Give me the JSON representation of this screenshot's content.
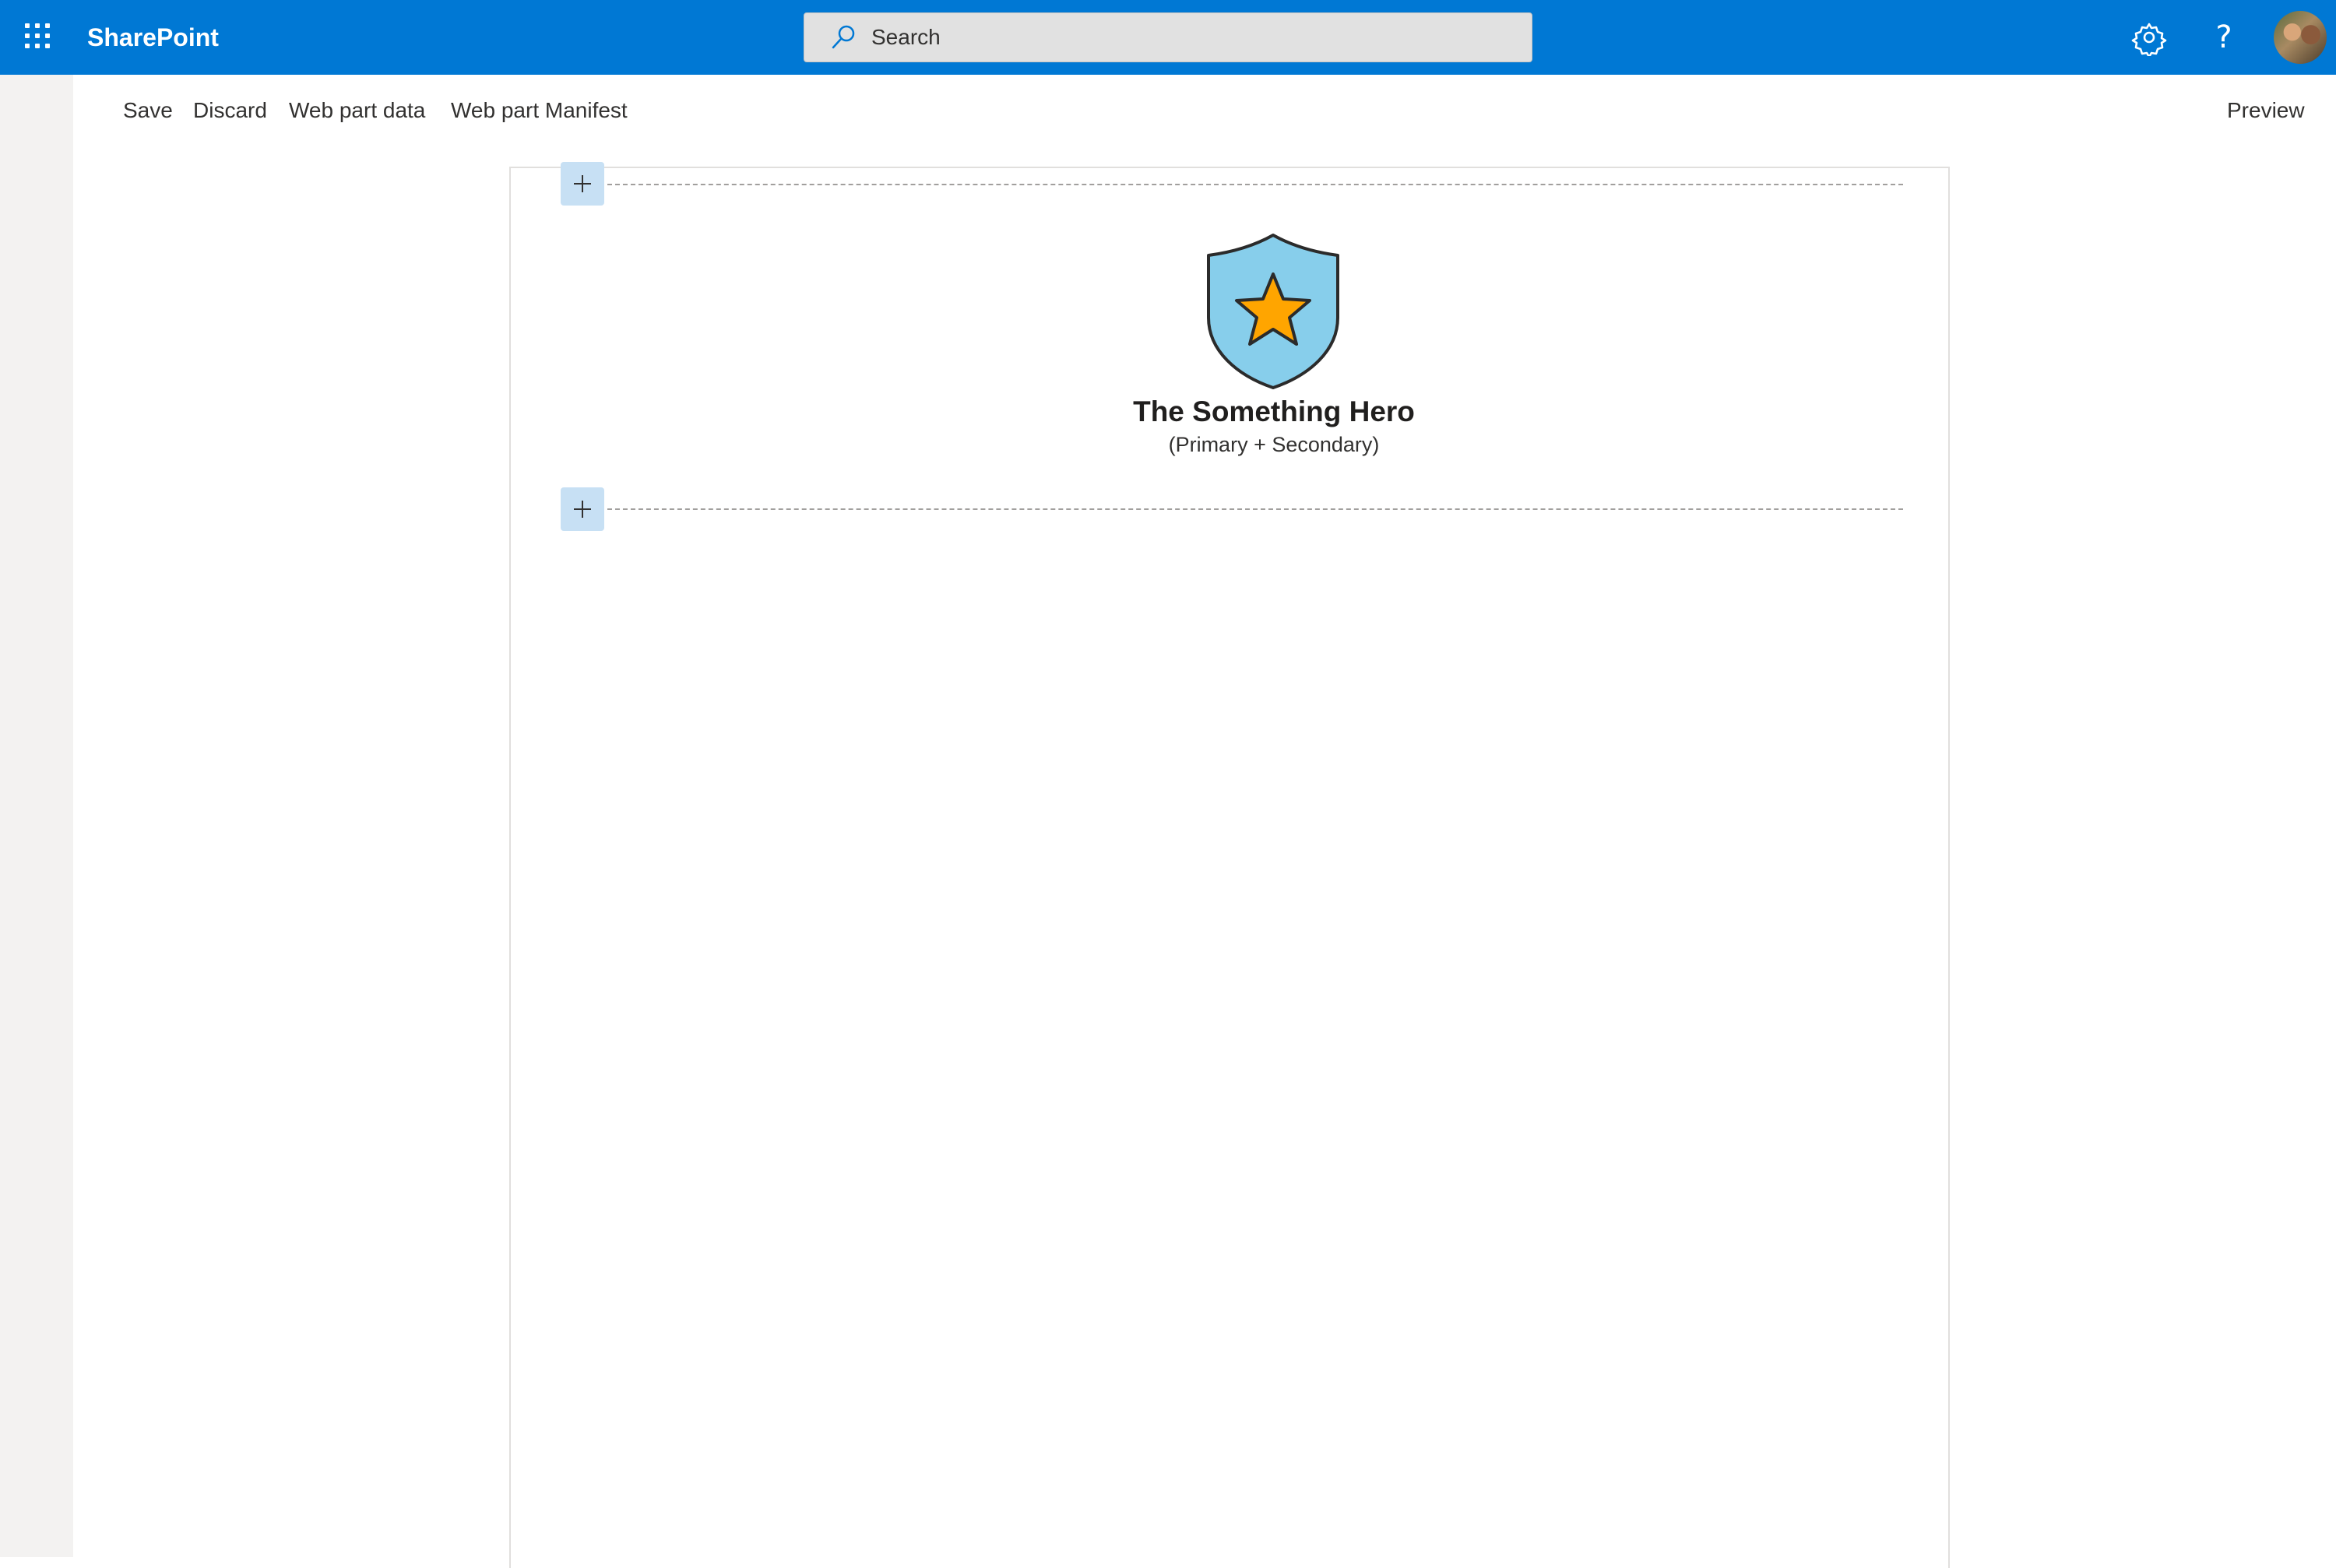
{
  "suite_bar": {
    "app_name": "SharePoint",
    "waffle_icon": "app-launcher-icon",
    "search_placeholder": "Search",
    "settings_icon": "gear-icon",
    "help_label": "?",
    "accent_color": "#0078d4"
  },
  "command_bar": {
    "save_label": "Save",
    "discard_label": "Discard",
    "web_part_data_label": "Web part data",
    "web_part_manifest_label": "Web part Manifest",
    "preview_label": "Preview"
  },
  "canvas": {
    "add_section_icon": "plus-icon",
    "web_part": {
      "icon": "shield-star-icon",
      "title": "The Something Hero",
      "subtitle": "(Primary + Secondary)"
    }
  }
}
